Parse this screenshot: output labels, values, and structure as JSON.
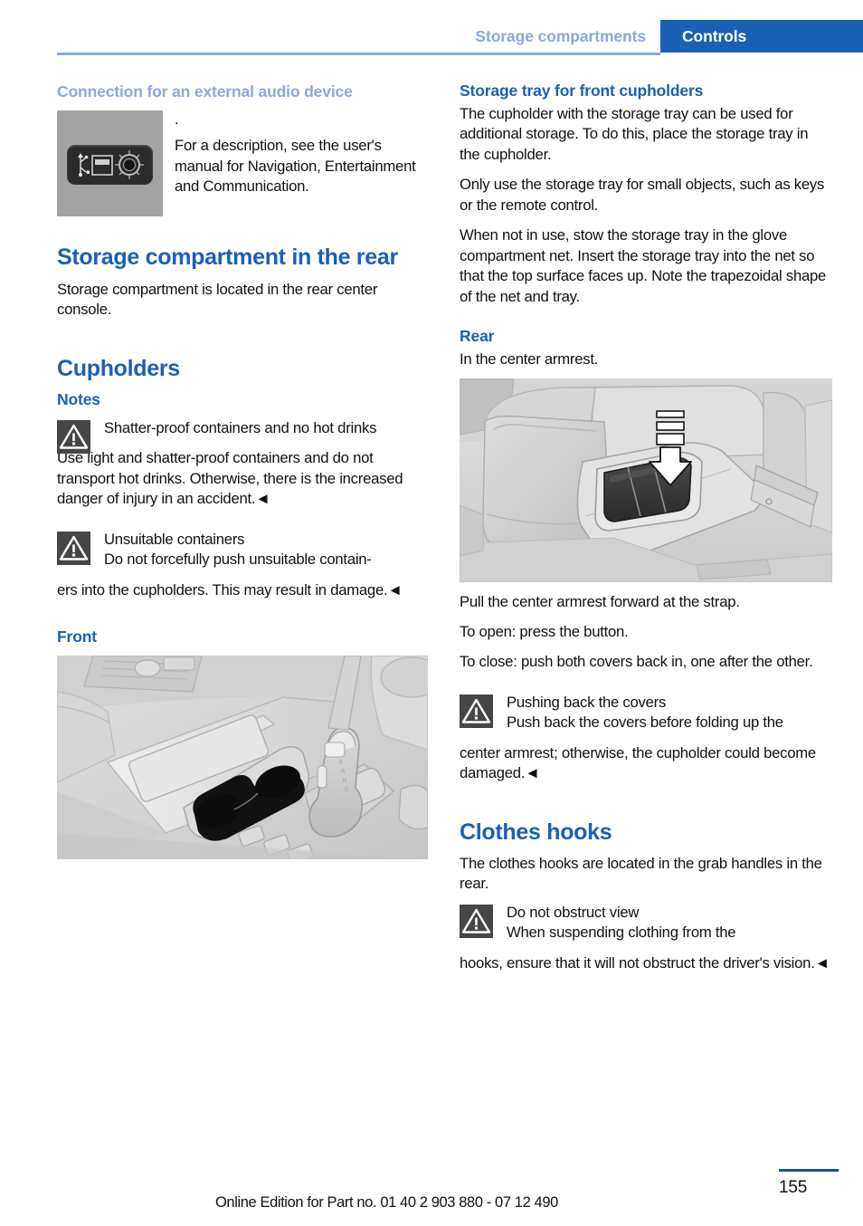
{
  "header": {
    "breadcrumb_section": "Storage compartments",
    "active_tab": "Controls",
    "accent_blue": "#1a60b4",
    "faded_blue": "#8da7de"
  },
  "left_column": {
    "audio_heading": "Connection for an external audio device",
    "aux_figure": {
      "icon_name": "usb-aux-port",
      "usb_label": "USB",
      "aux_label_left": "AUX-IN",
      "aux_label_right": "AUX-IN"
    },
    "aux_leading_dot": ".",
    "audio_body": "For a description, see the user's manual for Navigation, Entertainment and Communication.",
    "rear_storage_heading": "Storage compartment in the rear",
    "rear_storage_body": "Storage compartment is located in the rear center console.",
    "cupholders_heading": "Cupholders",
    "notes_heading": "Notes",
    "warning_1": {
      "title": "Shatter-proof containers and no hot drinks",
      "body": "Use light and shatter-proof containers and do not transport hot drinks. Otherwise, there is the increased danger of injury in an accident.◄"
    },
    "warning_2": {
      "title": "Unsuitable containers",
      "body_first": "Do not forcefully push unsuitable contain-",
      "body_rest": "ers into the cupholders. This may result in damage.◄"
    },
    "front_heading": "Front",
    "front_figure_caption": "front-center-console-cupholders-illustration"
  },
  "right_column": {
    "tray_heading": "Storage tray for front cupholders",
    "tray_p1": "The cupholder with the storage tray can be used for additional storage. To do this, place the storage tray in the cupholder.",
    "tray_p2": "Only use the storage tray for small objects, such as keys or the remote control.",
    "tray_p3": "When not in use, stow the storage tray in the glove compartment net. Insert the storage tray into the net so that the top surface faces up. Note the trapezoidal shape of the net and tray.",
    "rear_heading": "Rear",
    "rear_body": "In the center armrest.",
    "rear_figure_caption": "rear-center-armrest-cupholder-illustration",
    "rear_p1": "Pull the center armrest forward at the strap.",
    "rear_p2": "To open: press the button.",
    "rear_p3": "To close: push both covers back in, one after the other.",
    "warning_3": {
      "title": "Pushing back the covers",
      "body_first": "Push back the covers before folding up the",
      "body_rest": "center armrest; otherwise, the cupholder could become damaged.◄"
    },
    "clothes_heading": "Clothes hooks",
    "clothes_body": "The clothes hooks are located in the grab handles in the rear.",
    "warning_4": {
      "title": "Do not obstruct view",
      "body_first": "When suspending clothing from the",
      "body_rest": "hooks, ensure that it will not obstruct the driver's vision.◄"
    }
  },
  "footer": {
    "note": "Online Edition for Part no. 01 40 2 903 880 - 07 12 490",
    "page_number": "155"
  }
}
